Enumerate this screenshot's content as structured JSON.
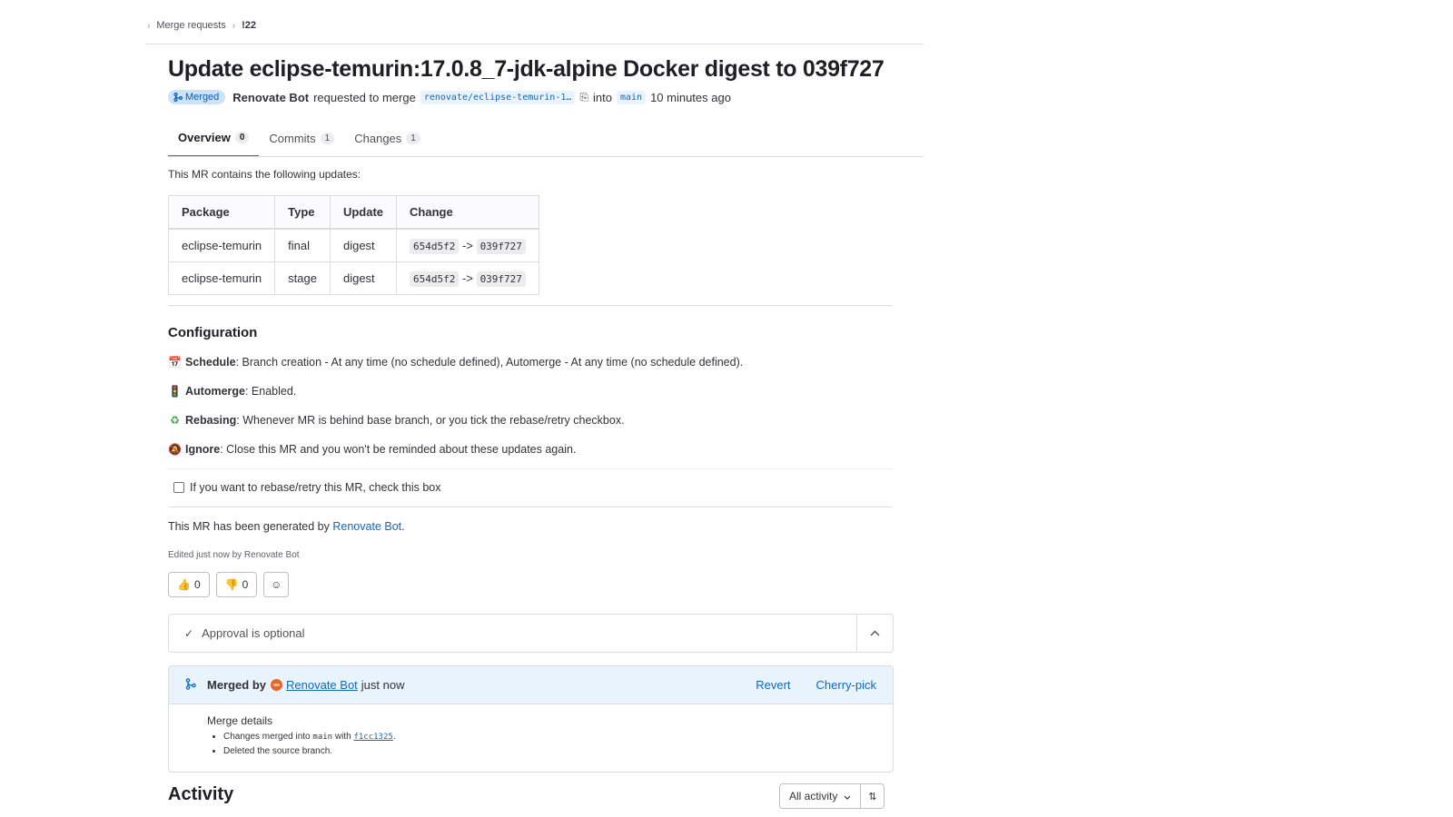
{
  "breadcrumb": {
    "parent": "Merge requests",
    "current": "!22"
  },
  "mr": {
    "title": "Update eclipse-temurin:17.0.8_7-jdk-alpine Docker digest to 039f727",
    "status": "Merged",
    "author": "Renovate Bot",
    "requested_text": "requested to merge",
    "source_branch": "renovate/eclipse-temurin-1…",
    "into_text": "into",
    "target_branch": "main",
    "time": "10 minutes ago"
  },
  "tabs": [
    {
      "label": "Overview",
      "count": "0"
    },
    {
      "label": "Commits",
      "count": "1"
    },
    {
      "label": "Changes",
      "count": "1"
    }
  ],
  "description": {
    "intro": "This MR contains the following updates:",
    "table": {
      "headers": [
        "Package",
        "Type",
        "Update",
        "Change"
      ],
      "rows": [
        {
          "package": "eclipse-temurin",
          "type": "final",
          "update": "digest",
          "from": "654d5f2",
          "arrow": "->",
          "to": "039f727"
        },
        {
          "package": "eclipse-temurin",
          "type": "stage",
          "update": "digest",
          "from": "654d5f2",
          "arrow": "->",
          "to": "039f727"
        }
      ]
    },
    "configuration_heading": "Configuration",
    "config": {
      "schedule_icon": "📅",
      "schedule_label": "Schedule",
      "schedule_text": ": Branch creation - At any time (no schedule defined), Automerge - At any time (no schedule defined).",
      "automerge_icon": "🚦",
      "automerge_label": "Automerge",
      "automerge_text": ": Enabled.",
      "rebasing_icon": "♻",
      "rebasing_label": "Rebasing",
      "rebasing_text": ": Whenever MR is behind base branch, or you tick the rebase/retry checkbox.",
      "ignore_icon": "🔕",
      "ignore_label": "Ignore",
      "ignore_text": ": Close this MR and you won't be reminded about these updates again."
    },
    "rebase_checkbox_label": "If you want to rebase/retry this MR, check this box",
    "generated_prefix": "This MR has been generated by",
    "generated_link": "Renovate Bot",
    "generated_suffix": ".",
    "edited": "Edited just now by Renovate Bot"
  },
  "reactions": {
    "thumbs_up": "👍",
    "thumbs_up_count": "0",
    "thumbs_down": "👎",
    "thumbs_down_count": "0",
    "add_emoji": "☺"
  },
  "approval": {
    "text": "Approval is optional"
  },
  "merged": {
    "label": "Merged by",
    "author": "Renovate Bot",
    "time": "just now",
    "revert": "Revert",
    "cherry_pick": "Cherry-pick",
    "details_title": "Merge details",
    "detail_1_prefix": "Changes merged into",
    "detail_1_branch": "main",
    "detail_1_with": "with",
    "detail_1_sha": "f1cc1325",
    "detail_1_suffix": ".",
    "detail_2": "Deleted the source branch."
  },
  "activity": {
    "heading": "Activity",
    "filter": "All activity"
  },
  "colors": {
    "accent": "#1f75cb",
    "link": "#1068bf",
    "merged_badge_bg": "#cbe2f9",
    "merged_box_bg": "#e9f3fc"
  }
}
